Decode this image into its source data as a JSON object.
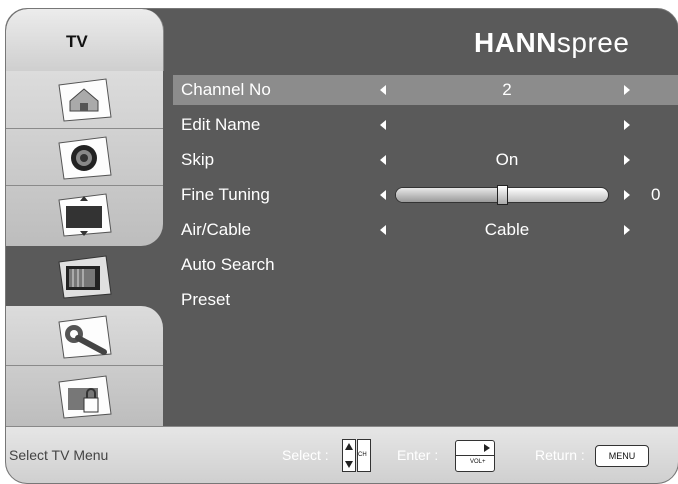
{
  "left_panel": {
    "title": "TV",
    "tabs": [
      {
        "name": "picture-icon"
      },
      {
        "name": "audio-icon"
      },
      {
        "name": "display-icon"
      },
      {
        "name": "tv-icon"
      },
      {
        "name": "setup-icon"
      },
      {
        "name": "lock-icon"
      }
    ],
    "selected_tab_index": 3
  },
  "header": {
    "brand_bold": "HANN",
    "brand_light": "spree"
  },
  "menu": {
    "items": [
      {
        "label": "Channel No",
        "value": "2",
        "has_arrows": true,
        "selected": true
      },
      {
        "label": "Edit Name",
        "value": "",
        "has_arrows": true
      },
      {
        "label": "Skip",
        "value": "On",
        "has_arrows": true
      },
      {
        "label": "Fine Tuning",
        "value": "",
        "has_arrows": true,
        "slider": true
      },
      {
        "label": "Air/Cable",
        "value": "Cable",
        "has_arrows": true
      },
      {
        "label": "Auto Search",
        "value": "",
        "has_arrows": false
      },
      {
        "label": "Preset",
        "value": "",
        "has_arrows": false
      }
    ],
    "fine_tuning": {
      "value_text": "0",
      "level_fraction": 0.5
    }
  },
  "footer": {
    "hint": "Select TV Menu",
    "select_label": "Select :",
    "select_key_text": "CH",
    "enter_label": "Enter :",
    "enter_key_text": "VOL+",
    "return_label": "Return :",
    "menu_key": "MENU"
  },
  "colors": {
    "panel_bg": "#5a5a5a",
    "selected_row": "#8c8c8c",
    "text": "#ffffff"
  }
}
